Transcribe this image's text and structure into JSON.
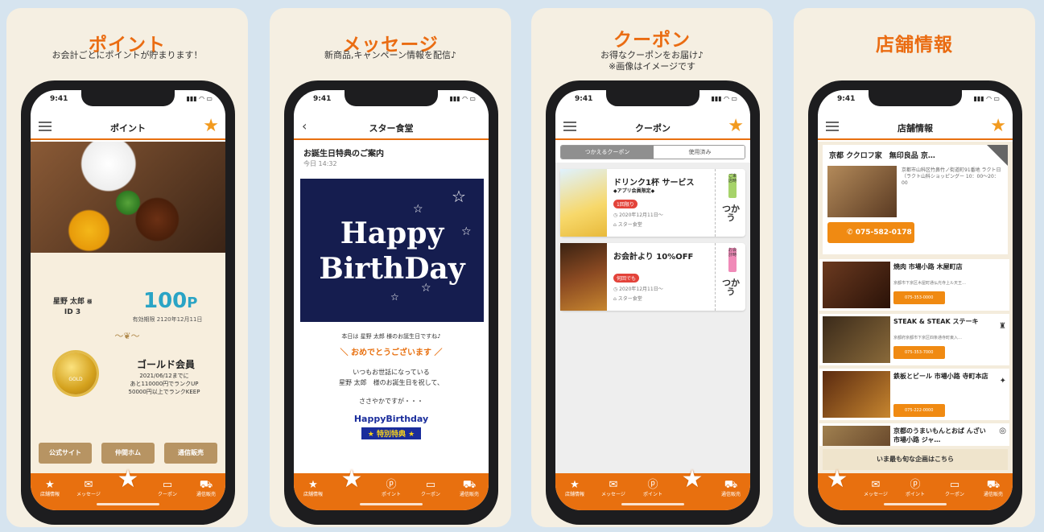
{
  "colors": {
    "accent": "#e8700f",
    "title": "#ea6c12",
    "points": "#2aa4c5"
  },
  "status_time": "9:41",
  "tabs": [
    "店舗情報",
    "メッセージ",
    "ポイント",
    "クーポン",
    "通信販売"
  ],
  "cards": [
    {
      "title": "ポイント",
      "subtitle": "お会計ごとにポイントが貯まります！",
      "nav_title": "ポイント",
      "user_name": "星野 太郎",
      "user_suffix": "様",
      "user_id": "ID 3",
      "points": "100",
      "points_unit": "P",
      "expiry": "有効期限 2120年12月11日",
      "rank_title": "ゴールド会員",
      "rank_info_1": "2021/06/12までに",
      "rank_info_2": "あと110000円でランクUP",
      "rank_info_3": "50000円以上でランクKEEP",
      "medal_label": "GOLD",
      "buttons": [
        "公式サイト",
        "仲間ホム",
        "通信販売"
      ]
    },
    {
      "title": "メッセージ",
      "subtitle": "新商品,キャンペーン情報を配信♪",
      "nav_title": "スター食堂",
      "msg_title": "お誕生日特典のご案内",
      "msg_time": "今日 14:32",
      "card_line1": "Happy",
      "card_line2": "BirthDay",
      "body1": "本日は 星野 太郎 様のお誕生日ですね♪",
      "body2": "＼ おめでとうございます ／",
      "body3a": "いつもお世話になっている",
      "body3b": "星野 太郎　様のお誕生日を祝して、",
      "body4": "ささやかですが・・・",
      "hb": "HappyBirthday",
      "tokuten": "★ 特別特典 ★"
    },
    {
      "title": "クーポン",
      "subtitle1": "お得なクーポンをお届け♪",
      "subtitle2": "※画像はイメージです",
      "nav_title": "クーポン",
      "seg_active": "つかえるクーポン",
      "seg_inactive": "使用済み",
      "coupons": [
        {
          "title": "ドリンク1杯 サービス",
          "sub": "◆アプリ会員限定◆",
          "badge": "1回限り",
          "date": "2020年12月11日～",
          "shop": "スター食堂",
          "tag": "ご来店時",
          "use": "つかう",
          "tag_color": "#a6d36a"
        },
        {
          "title": "お会計より 10%OFF",
          "sub": "",
          "badge": "何回でも",
          "date": "2020年12月11日～",
          "shop": "スター食堂",
          "tag": "お会計時",
          "use": "つかう",
          "tag_color": "#f08ab8"
        }
      ]
    },
    {
      "title": "店舗情報",
      "nav_title": "店舗情報",
      "main_name": "京都 ククロフ家　無印良品 京…",
      "main_addr": "京都市山科区竹鼻竹ノ街道町91番地 ラクト日（ラクト山科ショッピングー 10：00～20：00",
      "main_tel": "075-582-0178",
      "shops": [
        {
          "name": "焼肉 市場小路 木屋町店",
          "addr": "京都市下京区木屋町通仏光寺上ル天王…",
          "tel": "075-353-0000"
        },
        {
          "name": "STEAK & STEAK ステーキ",
          "addr": "京都府京都市下京区四条通寺町東入…",
          "tel": "075-353-7000"
        },
        {
          "name": "鉄板とビール 市場小路 寺町本店",
          "addr": "",
          "tel": "075-222-0000"
        },
        {
          "name": "京都のうまいもんとおば んざい 市場小路 ジャ…",
          "addr": "",
          "tel": ""
        }
      ],
      "recruit": "いま最も旬な企画はこちら"
    }
  ]
}
